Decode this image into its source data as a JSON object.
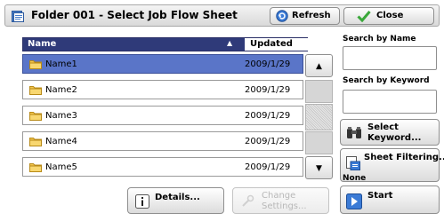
{
  "header": {
    "title": "Folder 001 - Select Job Flow Sheet",
    "title_icon": "folder-sheet-icon",
    "refresh_label": "Refresh",
    "close_label": "Close"
  },
  "list": {
    "columns": {
      "name": "Name",
      "updated": "Updated"
    },
    "sort_indicator": "▲",
    "rows": [
      {
        "name": "Name1",
        "updated": "2009/1/29",
        "selected": true
      },
      {
        "name": "Name2",
        "updated": "2009/1/29",
        "selected": false
      },
      {
        "name": "Name3",
        "updated": "2009/1/29",
        "selected": false
      },
      {
        "name": "Name4",
        "updated": "2009/1/29",
        "selected": false
      },
      {
        "name": "Name5",
        "updated": "2009/1/29",
        "selected": false
      }
    ],
    "scroll_up": "▲",
    "scroll_down": "▼"
  },
  "bottom": {
    "details_label": "Details...",
    "change_settings_line1": "Change",
    "change_settings_line2": "Settings..."
  },
  "side": {
    "search_by_name_label": "Search by Name",
    "search_by_name_value": "",
    "search_by_keyword_label": "Search by Keyword",
    "search_by_keyword_value": "",
    "select_keyword_line1": "Select",
    "select_keyword_line2": "Keyword...",
    "sheet_filtering_label": "Sheet Filtering...",
    "sheet_filtering_status": "None",
    "start_label": "Start"
  },
  "colors": {
    "header_bg": "#2f3a79",
    "selected_row": "#5a75c8",
    "accent_green": "#3aa83a"
  }
}
